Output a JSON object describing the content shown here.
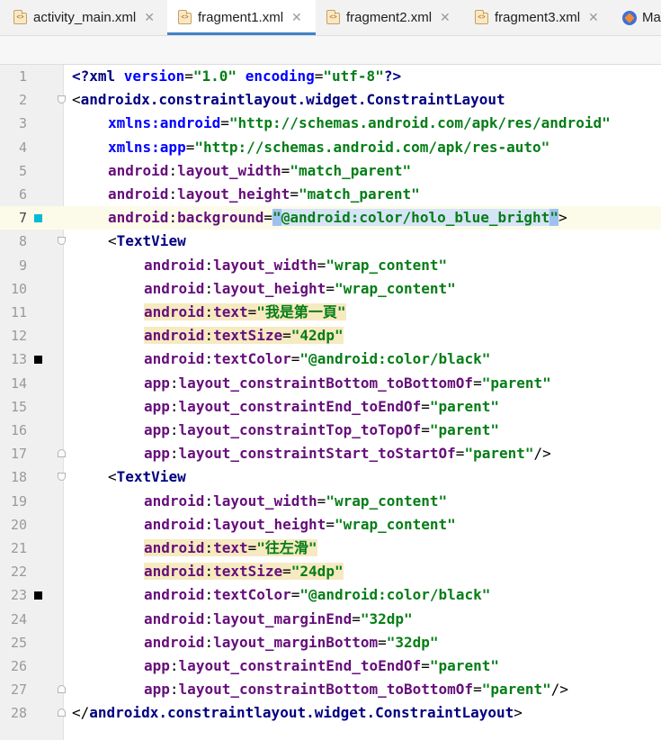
{
  "tabs": [
    {
      "label": "activity_main.xml",
      "active": false,
      "icon": "xml-file-icon",
      "close": "✕"
    },
    {
      "label": "fragment1.xml",
      "active": true,
      "icon": "xml-file-icon",
      "close": "✕"
    },
    {
      "label": "fragment2.xml",
      "active": false,
      "icon": "xml-file-icon",
      "close": "✕"
    },
    {
      "label": "fragment3.xml",
      "active": false,
      "icon": "xml-file-icon",
      "close": "✕"
    },
    {
      "label": "Ma",
      "active": false,
      "icon": "kotlin-file-icon",
      "close": ""
    }
  ],
  "editor": {
    "caret_line": 7,
    "gutter_markers": [
      {
        "line": 7,
        "color": "#00bcd4"
      },
      {
        "line": 13,
        "color": "#000000"
      },
      {
        "line": 23,
        "color": "#000000"
      }
    ],
    "lines": [
      {
        "n": "1",
        "indent": 0,
        "tokens": [
          [
            "pi",
            "<?xml "
          ],
          [
            "attr",
            "version"
          ],
          [
            "pun",
            "="
          ],
          [
            "val",
            "\"1.0\""
          ],
          [
            "pun",
            " "
          ],
          [
            "attr",
            "encoding"
          ],
          [
            "pun",
            "="
          ],
          [
            "val",
            "\"utf-8\""
          ],
          [
            "pi",
            "?>"
          ]
        ]
      },
      {
        "n": "2",
        "indent": 0,
        "fold": "open",
        "tokens": [
          [
            "pun",
            "<"
          ],
          [
            "tag",
            "androidx.constraintlayout.widget.ConstraintLayout"
          ]
        ]
      },
      {
        "n": "3",
        "indent": 4,
        "tokens": [
          [
            "attr",
            "xmlns:android"
          ],
          [
            "pun",
            "="
          ],
          [
            "val",
            "\"http://schemas.android.com/apk/res/android\""
          ]
        ]
      },
      {
        "n": "4",
        "indent": 4,
        "tokens": [
          [
            "attr",
            "xmlns:app"
          ],
          [
            "pun",
            "="
          ],
          [
            "val",
            "\"http://schemas.android.com/apk/res-auto\""
          ]
        ]
      },
      {
        "n": "5",
        "indent": 4,
        "tokens": [
          [
            "ns",
            "android"
          ],
          [
            "pun",
            ":"
          ],
          [
            "ns",
            "layout_width"
          ],
          [
            "pun",
            "="
          ],
          [
            "val",
            "\"match_parent\""
          ]
        ]
      },
      {
        "n": "6",
        "indent": 4,
        "tokens": [
          [
            "ns",
            "android"
          ],
          [
            "pun",
            ":"
          ],
          [
            "ns",
            "layout_height"
          ],
          [
            "pun",
            "="
          ],
          [
            "val",
            "\"match_parent\""
          ]
        ]
      },
      {
        "n": "7",
        "indent": 4,
        "tokens": [
          [
            "ns",
            "android"
          ],
          [
            "pun",
            ":"
          ],
          [
            "ns",
            "background"
          ],
          [
            "pun",
            "="
          ],
          [
            "val-brace",
            "\""
          ],
          [
            "val-ref",
            "@android:color/holo_blue_bright"
          ],
          [
            "val-brace",
            "\""
          ],
          [
            "pun",
            ">"
          ]
        ]
      },
      {
        "n": "8",
        "indent": 4,
        "fold": "open",
        "tokens": [
          [
            "pun",
            "<"
          ],
          [
            "tag",
            "TextView"
          ]
        ]
      },
      {
        "n": "9",
        "indent": 8,
        "tokens": [
          [
            "ns",
            "android"
          ],
          [
            "pun",
            ":"
          ],
          [
            "ns",
            "layout_width"
          ],
          [
            "pun",
            "="
          ],
          [
            "val",
            "\"wrap_content\""
          ]
        ]
      },
      {
        "n": "10",
        "indent": 8,
        "tokens": [
          [
            "ns",
            "android"
          ],
          [
            "pun",
            ":"
          ],
          [
            "ns",
            "layout_height"
          ],
          [
            "pun",
            "="
          ],
          [
            "val",
            "\"wrap_content\""
          ]
        ]
      },
      {
        "n": "11",
        "indent": 8,
        "lint": true,
        "tokens": [
          [
            "ns",
            "android"
          ],
          [
            "pun",
            ":"
          ],
          [
            "ns",
            "text"
          ],
          [
            "pun",
            "="
          ],
          [
            "val",
            "\"我是第一頁\""
          ]
        ]
      },
      {
        "n": "12",
        "indent": 8,
        "lint": true,
        "tokens": [
          [
            "ns",
            "android"
          ],
          [
            "pun",
            ":"
          ],
          [
            "ns",
            "textSize"
          ],
          [
            "pun",
            "="
          ],
          [
            "val",
            "\"42dp\""
          ]
        ]
      },
      {
        "n": "13",
        "indent": 8,
        "tokens": [
          [
            "ns",
            "android"
          ],
          [
            "pun",
            ":"
          ],
          [
            "ns",
            "textColor"
          ],
          [
            "pun",
            "="
          ],
          [
            "val",
            "\"@android:color/black\""
          ]
        ]
      },
      {
        "n": "14",
        "indent": 8,
        "tokens": [
          [
            "ns",
            "app"
          ],
          [
            "pun",
            ":"
          ],
          [
            "ns",
            "layout_constraintBottom_toBottomOf"
          ],
          [
            "pun",
            "="
          ],
          [
            "val",
            "\"parent\""
          ]
        ]
      },
      {
        "n": "15",
        "indent": 8,
        "tokens": [
          [
            "ns",
            "app"
          ],
          [
            "pun",
            ":"
          ],
          [
            "ns",
            "layout_constraintEnd_toEndOf"
          ],
          [
            "pun",
            "="
          ],
          [
            "val",
            "\"parent\""
          ]
        ]
      },
      {
        "n": "16",
        "indent": 8,
        "tokens": [
          [
            "ns",
            "app"
          ],
          [
            "pun",
            ":"
          ],
          [
            "ns",
            "layout_constraintTop_toTopOf"
          ],
          [
            "pun",
            "="
          ],
          [
            "val",
            "\"parent\""
          ]
        ]
      },
      {
        "n": "17",
        "indent": 8,
        "fold": "close",
        "tokens": [
          [
            "ns",
            "app"
          ],
          [
            "pun",
            ":"
          ],
          [
            "ns",
            "layout_constraintStart_toStartOf"
          ],
          [
            "pun",
            "="
          ],
          [
            "val",
            "\"parent\""
          ],
          [
            "pun",
            "/>"
          ]
        ]
      },
      {
        "n": "18",
        "indent": 4,
        "fold": "open",
        "tokens": [
          [
            "pun",
            "<"
          ],
          [
            "tag",
            "TextView"
          ]
        ]
      },
      {
        "n": "19",
        "indent": 8,
        "tokens": [
          [
            "ns",
            "android"
          ],
          [
            "pun",
            ":"
          ],
          [
            "ns",
            "layout_width"
          ],
          [
            "pun",
            "="
          ],
          [
            "val",
            "\"wrap_content\""
          ]
        ]
      },
      {
        "n": "20",
        "indent": 8,
        "tokens": [
          [
            "ns",
            "android"
          ],
          [
            "pun",
            ":"
          ],
          [
            "ns",
            "layout_height"
          ],
          [
            "pun",
            "="
          ],
          [
            "val",
            "\"wrap_content\""
          ]
        ]
      },
      {
        "n": "21",
        "indent": 8,
        "lint": true,
        "tokens": [
          [
            "ns",
            "android"
          ],
          [
            "pun",
            ":"
          ],
          [
            "ns",
            "text"
          ],
          [
            "pun",
            "="
          ],
          [
            "val",
            "\"往左滑\""
          ]
        ]
      },
      {
        "n": "22",
        "indent": 8,
        "lint": true,
        "tokens": [
          [
            "ns",
            "android"
          ],
          [
            "pun",
            ":"
          ],
          [
            "ns",
            "textSize"
          ],
          [
            "pun",
            "="
          ],
          [
            "val",
            "\"24dp\""
          ]
        ]
      },
      {
        "n": "23",
        "indent": 8,
        "tokens": [
          [
            "ns",
            "android"
          ],
          [
            "pun",
            ":"
          ],
          [
            "ns",
            "textColor"
          ],
          [
            "pun",
            "="
          ],
          [
            "val",
            "\"@android:color/black\""
          ]
        ]
      },
      {
        "n": "24",
        "indent": 8,
        "tokens": [
          [
            "ns",
            "android"
          ],
          [
            "pun",
            ":"
          ],
          [
            "ns",
            "layout_marginEnd"
          ],
          [
            "pun",
            "="
          ],
          [
            "val",
            "\"32dp\""
          ]
        ]
      },
      {
        "n": "25",
        "indent": 8,
        "tokens": [
          [
            "ns",
            "android"
          ],
          [
            "pun",
            ":"
          ],
          [
            "ns",
            "layout_marginBottom"
          ],
          [
            "pun",
            "="
          ],
          [
            "val",
            "\"32dp\""
          ]
        ]
      },
      {
        "n": "26",
        "indent": 8,
        "tokens": [
          [
            "ns",
            "app"
          ],
          [
            "pun",
            ":"
          ],
          [
            "ns",
            "layout_constraintEnd_toEndOf"
          ],
          [
            "pun",
            "="
          ],
          [
            "val",
            "\"parent\""
          ]
        ]
      },
      {
        "n": "27",
        "indent": 8,
        "fold": "close",
        "tokens": [
          [
            "ns",
            "app"
          ],
          [
            "pun",
            ":"
          ],
          [
            "ns",
            "layout_constraintBottom_toBottomOf"
          ],
          [
            "pun",
            "="
          ],
          [
            "val",
            "\"parent\""
          ],
          [
            "pun",
            "/>"
          ]
        ]
      },
      {
        "n": "28",
        "indent": 0,
        "fold": "close",
        "tokens": [
          [
            "pun",
            "</"
          ],
          [
            "tag",
            "androidx.constraintlayout.widget.ConstraintLayout"
          ],
          [
            "pun",
            ">"
          ]
        ]
      }
    ]
  }
}
